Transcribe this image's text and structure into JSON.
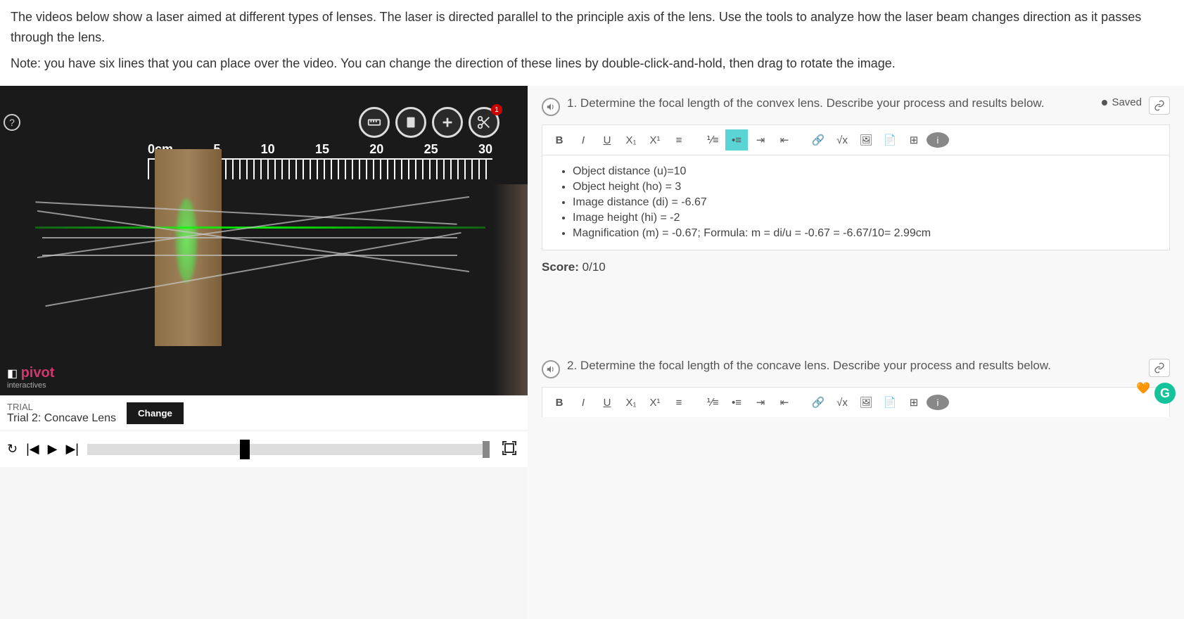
{
  "instructions": {
    "p1": "The videos below show a laser aimed at different types of lenses. The laser is directed parallel to the principle axis of the lens. Use the tools to analyze how the laser beam changes direction as it passes through the lens.",
    "p2": "Note: you have six lines that you can place over the video. You can change the direction of these lines by double-click-and-hold, then drag to rotate the image."
  },
  "ruler": {
    "labels": [
      "0cm",
      "5",
      "10",
      "15",
      "20",
      "25",
      "30"
    ]
  },
  "logo": {
    "main": "pivot",
    "sub": "interactives"
  },
  "trial": {
    "label": "TRIAL",
    "name": "Trial 2: Concave Lens",
    "change": "Change"
  },
  "q1": {
    "number": "1.",
    "text": "Determine the focal length of the convex lens. Describe your process and results below.",
    "saved": "Saved",
    "bullets": [
      "Object distance (u)=10",
      "Object height (ho) = 3",
      "Image distance (di) = -6.67",
      "Image height (hi) = -2",
      "Magnification (m) = -0.67;     Formula: m = di/u = -0.67 = -6.67/10= 2.99cm"
    ],
    "score_label": "Score:",
    "score_value": "0/10"
  },
  "q2": {
    "number": "2.",
    "text": "Determine the focal length of the concave lens. Describe your process and results below."
  },
  "toolbar": {
    "bold": "B",
    "italic": "I",
    "underline": "U",
    "sub": "X₁",
    "sup": "X¹",
    "math": "√x",
    "info": "i"
  }
}
